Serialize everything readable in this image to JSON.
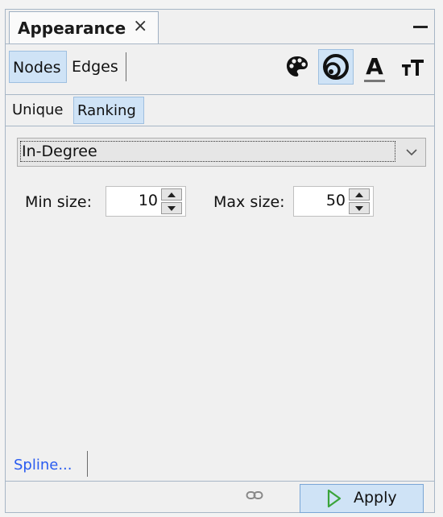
{
  "window": {
    "title": "Appearance",
    "close_glyph": "×"
  },
  "toolbar": {
    "tabs": [
      {
        "label": "Nodes",
        "selected": true
      },
      {
        "label": "Edges",
        "selected": false
      }
    ],
    "icons": [
      {
        "name": "color-palette-icon",
        "selected": false
      },
      {
        "name": "size-icon",
        "selected": true
      },
      {
        "name": "label-color-icon",
        "glyph": "A",
        "selected": false
      },
      {
        "name": "label-size-icon",
        "glyph": "тT",
        "selected": false
      }
    ]
  },
  "subtabs": [
    {
      "label": "Unique",
      "selected": false
    },
    {
      "label": "Ranking",
      "selected": true
    }
  ],
  "attribute_select": {
    "value": "In-Degree"
  },
  "size": {
    "min_label": "Min size:",
    "min_value": "10",
    "max_label": "Max size:",
    "max_value": "50"
  },
  "footer": {
    "spline_label": "Spline...",
    "apply_label": "Apply"
  },
  "colors": {
    "selected_bg": "#cfe3f6",
    "border": "#a7b6c6",
    "link": "#2a5cf0",
    "apply_icon": "#3aa43a"
  }
}
